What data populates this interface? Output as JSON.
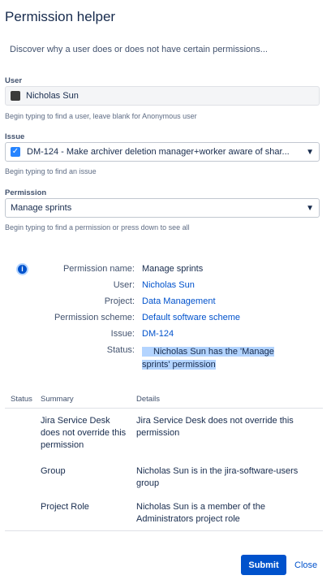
{
  "dialog": {
    "title": "Permission helper",
    "description": "Discover why a user does or does not have certain permissions..."
  },
  "form": {
    "user": {
      "label": "User",
      "value": "Nicholas Sun",
      "hint": "Begin typing to find a user, leave blank for Anonymous user"
    },
    "issue": {
      "label": "Issue",
      "value": "DM-124 - Make archiver deletion manager+worker aware of shar...",
      "hint": "Begin typing to find an issue"
    },
    "permission": {
      "label": "Permission",
      "value": "Manage sprints",
      "hint": "Begin typing to find a permission or press down to see all"
    }
  },
  "result": {
    "icon": "info-icon",
    "rows": [
      {
        "key": "Permission name:",
        "value": "Manage sprints"
      },
      {
        "key": "User:",
        "value": "Nicholas Sun"
      },
      {
        "key": "Project:",
        "value": "Data Management"
      },
      {
        "key": "Permission scheme:",
        "value": "Default software scheme"
      },
      {
        "key": "Issue:",
        "value": "DM-124"
      }
    ],
    "status_key": "Status:",
    "status_line1": "Nicholas Sun has the 'Manage",
    "status_line2": "sprints' permission"
  },
  "table": {
    "headers": {
      "status": "Status",
      "summary": "Summary",
      "details": "Details"
    },
    "rows": [
      {
        "summary": [
          "Jira Service Desk",
          "does not override this",
          "permission"
        ],
        "details": [
          "Jira Service Desk does not override this",
          "permission"
        ]
      },
      {
        "summary": [
          "Group"
        ],
        "details": [
          "Nicholas Sun is in the jira-software-users",
          "group"
        ]
      },
      {
        "summary": [
          "Project Role"
        ],
        "details": [
          "Nicholas Sun is a member of the",
          "Administrators project role"
        ]
      }
    ]
  },
  "footer": {
    "submit_label": "Submit",
    "close_label": "Close"
  },
  "colors": {
    "primary": "#0052cc",
    "link": "#0052cc",
    "highlight": "#b3d4ff",
    "checkbox": "#2684ff"
  }
}
